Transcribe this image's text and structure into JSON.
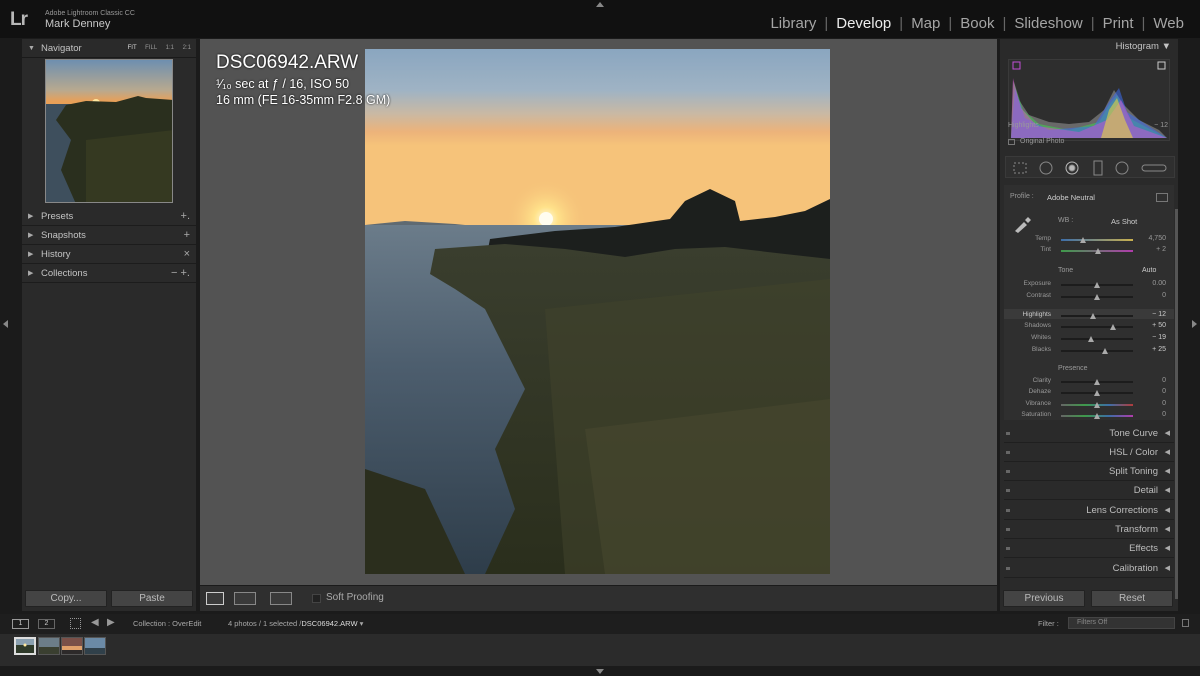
{
  "app": {
    "logo": "Lr",
    "name": "Adobe Lightroom Classic CC",
    "user": "Mark Denney"
  },
  "modules": [
    "Library",
    "Develop",
    "Map",
    "Book",
    "Slideshow",
    "Print",
    "Web"
  ],
  "active_module": "Develop",
  "left_panel": {
    "navigator": {
      "label": "Navigator",
      "options": [
        "FIT",
        "FILL",
        "1:1",
        "2:1"
      ]
    },
    "panels": [
      {
        "label": "Presets",
        "action": "+."
      },
      {
        "label": "Snapshots",
        "action": "+"
      },
      {
        "label": "History",
        "action": "×"
      },
      {
        "label": "Collections",
        "action": "− +."
      }
    ],
    "copy_label": "Copy...",
    "paste_label": "Paste"
  },
  "photo_info": {
    "filename": "DSC06942.ARW",
    "exposure": "¹⁄₁₀ sec at ƒ / 16, ISO 50",
    "lens": "16 mm (FE 16-35mm F2.8 GM)"
  },
  "toolbar": {
    "soft_proofing": "Soft Proofing"
  },
  "right_panel": {
    "histogram": {
      "label": "Histogram",
      "readout_name": "Highlights",
      "readout_value": "− 12",
      "original_photo": "Original Photo"
    },
    "profile": {
      "label": "Profile :",
      "value": "Adobe Neutral"
    },
    "wb": {
      "label": "WB :",
      "value": "As Shot"
    },
    "tone_label": "Tone",
    "auto_label": "Auto",
    "presence_label": "Presence",
    "sliders": [
      {
        "label": "Temp",
        "value": "4,750",
        "pos": 0.3
      },
      {
        "label": "Tint",
        "value": "+ 2",
        "pos": 0.51
      },
      {
        "label": "Exposure",
        "value": "0.00",
        "pos": 0.5
      },
      {
        "label": "Contrast",
        "value": "0",
        "pos": 0.5
      },
      {
        "label": "Highlights",
        "value": "− 12",
        "pos": 0.44
      },
      {
        "label": "Shadows",
        "value": "+ 50",
        "pos": 0.72
      },
      {
        "label": "Whites",
        "value": "− 19",
        "pos": 0.41
      },
      {
        "label": "Blacks",
        "value": "+ 25",
        "pos": 0.61
      },
      {
        "label": "Clarity",
        "value": "0",
        "pos": 0.5
      },
      {
        "label": "Dehaze",
        "value": "0",
        "pos": 0.5
      },
      {
        "label": "Vibrance",
        "value": "0",
        "pos": 0.5
      },
      {
        "label": "Saturation",
        "value": "0",
        "pos": 0.5
      }
    ],
    "sections": [
      "Tone Curve",
      "HSL / Color",
      "Split Toning",
      "Detail",
      "Lens Corrections",
      "Transform",
      "Effects",
      "Calibration"
    ],
    "previous_label": "Previous",
    "reset_label": "Reset"
  },
  "filmstrip": {
    "monitor1": "1",
    "monitor2": "2",
    "collection": "Collection : OverEdit",
    "count": "4 photos / 1 selected /",
    "selected_file": "DSC06942.ARW",
    "filter_label": "Filter :",
    "filter_value": "Filters Off"
  }
}
